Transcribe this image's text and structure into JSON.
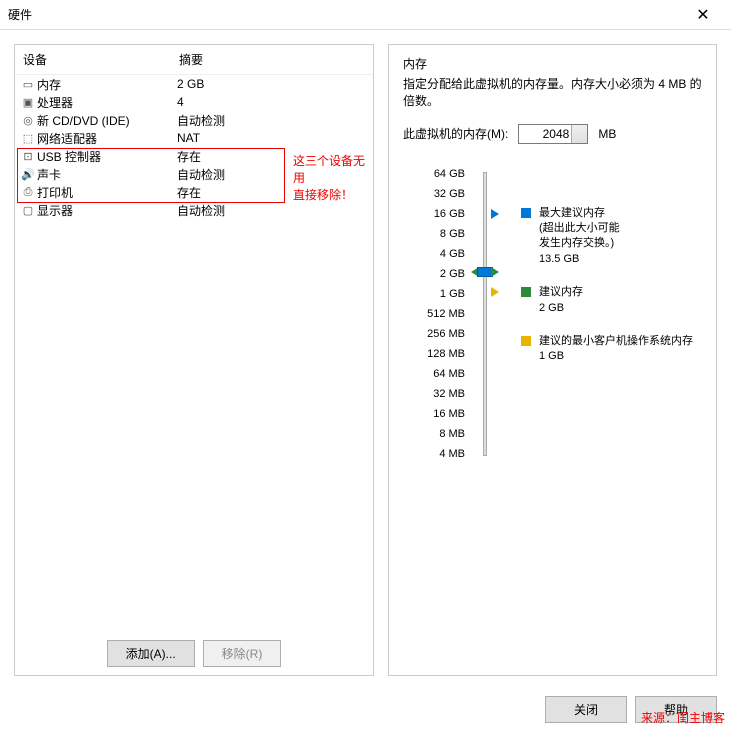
{
  "window": {
    "title": "硬件",
    "close": "✕"
  },
  "headers": {
    "device": "设备",
    "summary": "摘要"
  },
  "devices": [
    {
      "icon": "▭",
      "name": "内存",
      "summary": "2 GB"
    },
    {
      "icon": "▣",
      "name": "处理器",
      "summary": "4"
    },
    {
      "icon": "◎",
      "name": "新 CD/DVD (IDE)",
      "summary": "自动检测"
    },
    {
      "icon": "⬚",
      "name": "网络适配器",
      "summary": "NAT"
    },
    {
      "icon": "⊡",
      "name": "USB 控制器",
      "summary": "存在"
    },
    {
      "icon": "🔊",
      "name": "声卡",
      "summary": "自动检测"
    },
    {
      "icon": "⎙",
      "name": "打印机",
      "summary": "存在"
    },
    {
      "icon": "▢",
      "name": "显示器",
      "summary": "自动检测"
    }
  ],
  "annotation": {
    "line1": "这三个设备无用",
    "line2": "直接移除！"
  },
  "buttons": {
    "add": "添加(A)...",
    "remove": "移除(R)",
    "close": "关闭",
    "help": "帮助"
  },
  "memory": {
    "section": "内存",
    "desc": "指定分配给此虚拟机的内存量。内存大小必须为 4 MB 的倍数。",
    "label": "此虚拟机的内存(M):",
    "value": "2048",
    "unit": "MB",
    "ticks": [
      "64 GB",
      "32 GB",
      "16 GB",
      "8 GB",
      "4 GB",
      "2 GB",
      "1 GB",
      "512 MB",
      "256 MB",
      "128 MB",
      "64 MB",
      "32 MB",
      "16 MB",
      "8 MB",
      "4 MB"
    ],
    "legend": {
      "max": {
        "title": "最大建议内存",
        "note1": "(超出此大小可能",
        "note2": "发生内存交换。)",
        "value": "13.5 GB"
      },
      "rec": {
        "title": "建议内存",
        "value": "2 GB"
      },
      "min": {
        "title": "建议的最小客户机操作系统内存",
        "value": "1 GB"
      }
    }
  },
  "watermark": "来源：闺主博客"
}
